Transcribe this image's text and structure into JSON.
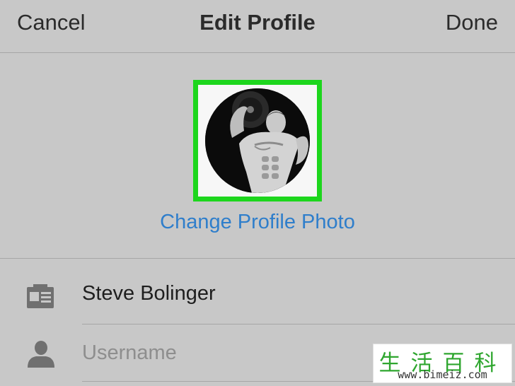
{
  "navbar": {
    "cancel_label": "Cancel",
    "title": "Edit Profile",
    "done_label": "Done"
  },
  "profile": {
    "change_photo_label": "Change Profile Photo",
    "highlight_color": "#1dd61d",
    "link_color": "#2f7ecb"
  },
  "fields": {
    "name_value": "Steve Bolinger",
    "name_icon": "id-card-icon",
    "username_placeholder": "Username",
    "username_icon": "person-icon"
  },
  "watermark": {
    "chars": "生活百科",
    "url": "www.bimeiz.com"
  }
}
